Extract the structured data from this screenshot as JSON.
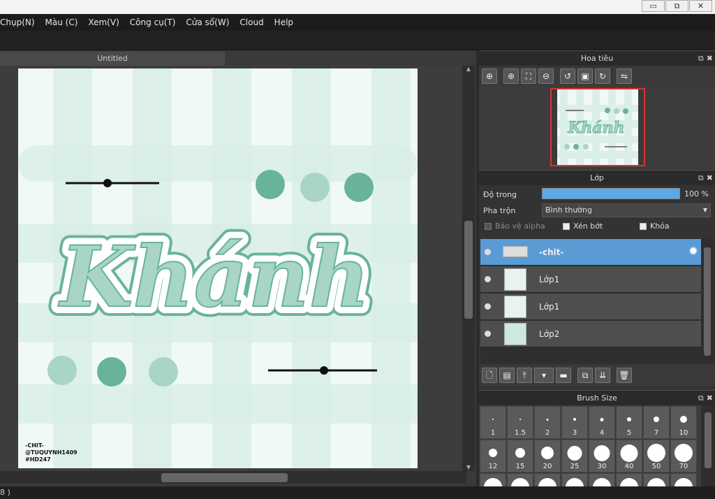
{
  "window": {
    "controls": [
      "▭",
      "⧉",
      "✕"
    ]
  },
  "menu": {
    "items": [
      "Chụp(N)",
      "Màu (C)",
      "Xem(V)",
      "Công cụ(T)",
      "Cửa sổ(W)",
      "Cloud",
      "Help"
    ]
  },
  "document": {
    "tab_title": "Untitled"
  },
  "canvas_art": {
    "title_text": "Khánh",
    "credit_lines": [
      "-CHIT-",
      "@TUQUYNH1409",
      "#HD247"
    ],
    "accent_colors": [
      "#6ab39b",
      "#a8d5c6",
      "#e6f3ee"
    ]
  },
  "navigator": {
    "title": "Hoa tiêu",
    "preview_text": "Khánh",
    "tools": [
      "zoom-fit-icon",
      "zoom-in-icon",
      "fit-window-icon",
      "zoom-out-icon",
      "rotate-left-icon",
      "actual-size-icon",
      "rotate-right-icon",
      "flip-icon"
    ]
  },
  "layers_panel": {
    "title": "Lớp",
    "opacity_label": "Độ trong",
    "opacity_value": "100 %",
    "opacity_fraction": 1.0,
    "blend_label": "Pha trộn",
    "blend_value": "Bình thường",
    "protect_alpha": "Bảo vệ alpha",
    "clipping": "Xén bớt",
    "lock": "Khóa",
    "layers": [
      {
        "name": "-chit-",
        "active": true
      },
      {
        "name": "Lớp1",
        "active": false
      },
      {
        "name": "Lớp1",
        "active": false
      },
      {
        "name": "Lớp2",
        "active": false
      }
    ]
  },
  "brush_panel": {
    "title": "Brush Size",
    "sizes": [
      "1",
      "1.5",
      "2",
      "3",
      "4",
      "5",
      "7",
      "10",
      "12",
      "15",
      "20",
      "25",
      "30",
      "40",
      "50",
      "70"
    ]
  },
  "status": {
    "text": "8 )"
  }
}
